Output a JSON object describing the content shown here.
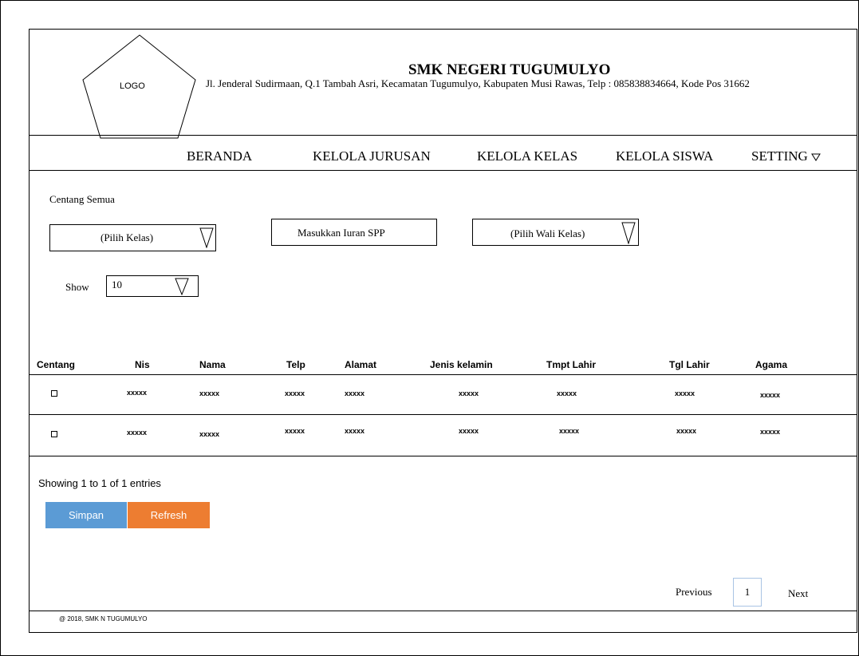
{
  "header": {
    "logo_text": "LOGO",
    "school_name": "SMK NEGERI TUGUMULYO",
    "address": "Jl. Jenderal Sudirmaan, Q.1 Tambah Asri, Kecamatan Tugumulyo, Kabupaten Musi Rawas, Telp : 085838834664, Kode Pos 31662"
  },
  "nav": {
    "beranda": "BERANDA",
    "kelola_jurusan": "KELOLA JURUSAN",
    "kelola_kelas": "KELOLA KELAS",
    "kelola_siswa": "KELOLA SISWA",
    "setting": "SETTING",
    "setting_icon": "triangle-down-icon"
  },
  "form": {
    "select_all_label": "Centang Semua",
    "kelas_select": "(Pilih Kelas)",
    "iuran_button": "Masukkan Iuran SPP",
    "wali_select": "(Pilih Wali Kelas)",
    "show_label": "Show",
    "show_value": "10"
  },
  "table": {
    "headers": {
      "centang": "Centang",
      "nis": "Nis",
      "nama": "Nama",
      "telp": "Telp",
      "alamat": "Alamat",
      "jenis_kelamin": "Jenis kelamin",
      "tmpt_lahir": "Tmpt Lahir",
      "tgl_lahir": "Tgl Lahir",
      "agama": "Agama"
    },
    "rows": [
      {
        "nis": "xxxxx",
        "nama": "xxxxx",
        "telp": "xxxxx",
        "alamat": "xxxxx",
        "jenis_kelamin": "xxxxx",
        "tmpt_lahir": "xxxxx",
        "tgl_lahir": "xxxxx",
        "agama": "xxxxx"
      },
      {
        "nis": "xxxxx",
        "nama": "xxxxx",
        "telp": "xxxxx",
        "alamat": "xxxxx",
        "jenis_kelamin": "xxxxx",
        "tmpt_lahir": "xxxxx",
        "tgl_lahir": "xxxxx",
        "agama": "xxxxx"
      }
    ]
  },
  "entries_info": "Showing 1 to 1 of 1 entries",
  "buttons": {
    "simpan": "Simpan",
    "refresh": "Refresh"
  },
  "colors": {
    "simpan": "#5b9bd5",
    "refresh": "#ed7d31"
  },
  "pagination": {
    "previous": "Previous",
    "page": "1",
    "next": "Next"
  },
  "footer": "@ 2018, SMK N TUGUMULYO"
}
